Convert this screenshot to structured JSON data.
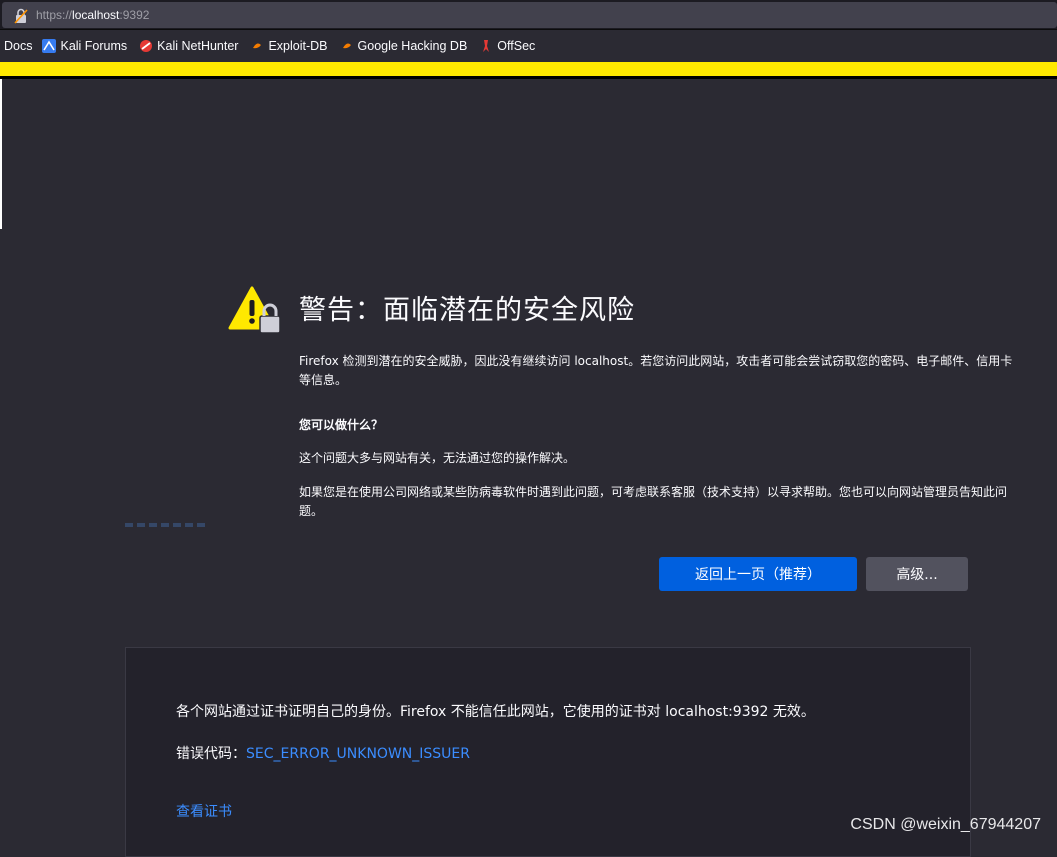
{
  "urlbar": {
    "scheme": "https://",
    "host": "localhost",
    "port": ":9392"
  },
  "bookmarks": {
    "items": [
      {
        "label": "Docs",
        "icon": "none"
      },
      {
        "label": "Kali Forums",
        "icon": "kali-dragon-icon"
      },
      {
        "label": "Kali NetHunter",
        "icon": "nethunter-icon"
      },
      {
        "label": "Exploit-DB",
        "icon": "exploit-db-icon"
      },
      {
        "label": "Google Hacking DB",
        "icon": "ghdb-icon"
      },
      {
        "label": "OffSec",
        "icon": "offsec-icon"
      }
    ]
  },
  "warning": {
    "title": "警告：面临潜在的安全风险",
    "p1": "Firefox 检测到潜在的安全威胁，因此没有继续访问 localhost。若您访问此网站，攻击者可能会尝试窃取您的密码、电子邮件、信用卡等信息。",
    "question": "您可以做什么？",
    "p2": "这个问题大多与网站有关，无法通过您的操作解决。",
    "p3": "如果您是在使用公司网络或某些防病毒软件时遇到此问题，可考虑联系客服（技术支持）以寻求帮助。您也可以向网站管理员告知此问题。"
  },
  "buttons": {
    "back": "返回上一页（推荐）",
    "advanced": "高级..."
  },
  "advanced_panel": {
    "text": "各个网站通过证书证明自己的身份。Firefox 不能信任此网站，它使用的证书对 localhost:9392 无效。",
    "error_label": "错误代码：",
    "error_code": "SEC_ERROR_UNKNOWN_ISSUER",
    "view_cert": "查看证书"
  },
  "watermark": "CSDN @weixin_67944207",
  "colors": {
    "background": "#2b2a33",
    "stripe": "#ffe900",
    "primary_button": "#0060df",
    "link": "#3b8dff"
  }
}
